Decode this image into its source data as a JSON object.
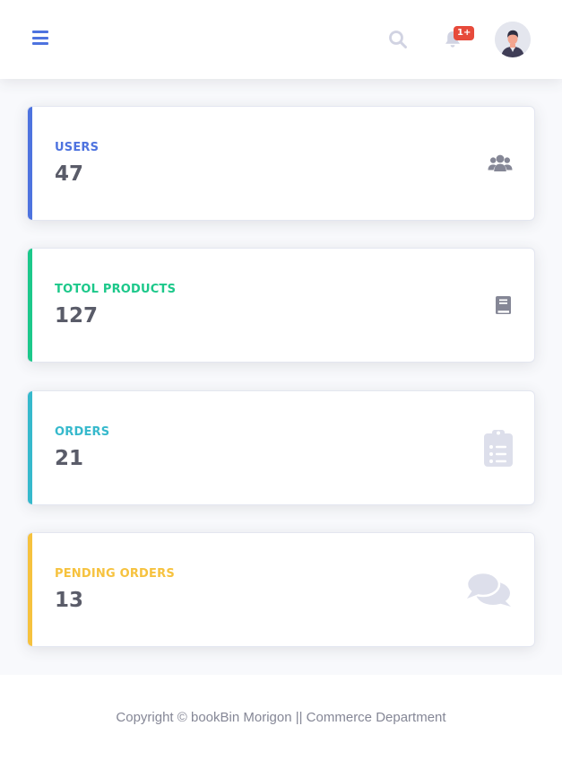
{
  "header": {
    "menu_icon": "hamburger-menu-icon",
    "search_icon": "search-icon",
    "bell_icon": "bell-icon",
    "notification_badge": "1+",
    "avatar_icon": "user-avatar-icon"
  },
  "cards": [
    {
      "label": "USERS",
      "value": "47",
      "icon": "users-icon",
      "accent_color": "#4e73df"
    },
    {
      "label": "TOTOL PRODUCTS",
      "value": "127",
      "icon": "book-icon",
      "accent_color": "#1cc88a"
    },
    {
      "label": "ORDERS",
      "value": "21",
      "icon": "clipboard-list-icon",
      "accent_color": "#36b9cc"
    },
    {
      "label": "PENDING ORDERS",
      "value": "13",
      "icon": "comments-icon",
      "accent_color": "#f6c23e"
    }
  ],
  "footer": {
    "copyright": "Copyright © bookBin Morigon || Commerce Department"
  }
}
